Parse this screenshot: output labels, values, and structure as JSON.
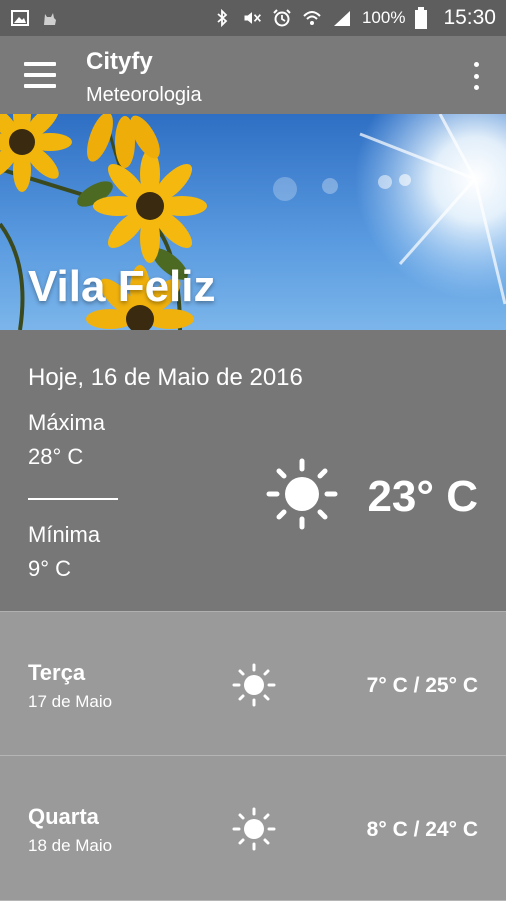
{
  "status_bar": {
    "icons_left": [
      "gallery-icon",
      "cat-icon"
    ],
    "icons_right": [
      "bluetooth-icon",
      "mute-icon",
      "alarm-icon",
      "wifi-icon",
      "signal-icon",
      "battery-icon"
    ],
    "battery": "100%",
    "time": "15:30"
  },
  "app_bar": {
    "title": "Cityfy",
    "subtitle": "Meteorologia"
  },
  "hero": {
    "city": "Vila Feliz"
  },
  "today": {
    "date": "Hoje, 16 de Maio de 2016",
    "max_label": "Máxima",
    "max_value": "28° C",
    "min_label": "Mínima",
    "min_value": "9° C",
    "current_temp": "23° C",
    "icon": "sun-icon"
  },
  "forecast": [
    {
      "day": "Terça",
      "date": "17 de Maio",
      "temp": "7° C / 25° C",
      "icon": "sun-icon"
    },
    {
      "day": "Quarta",
      "date": "18 de Maio",
      "temp": "8° C / 24° C",
      "icon": "sun-icon"
    }
  ],
  "colors": {
    "status_bar": "#5e5e5e",
    "app_bar": "#7a7a7a",
    "today_bg": "#777777",
    "forecast_bg": "#9a9a9a",
    "text": "#ffffff"
  }
}
